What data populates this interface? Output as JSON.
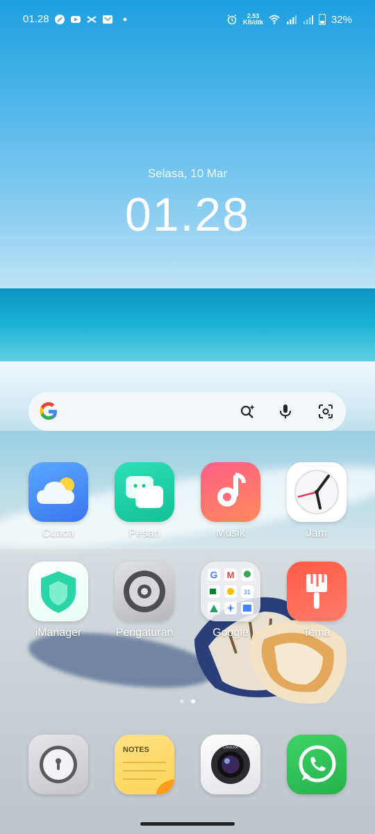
{
  "status_bar": {
    "time": "01.28",
    "net_speed_value": "2.53",
    "net_speed_unit": "KB/dtk",
    "battery": "32%",
    "left_icons": [
      "app-notification-icon",
      "youtube-icon",
      "capcut-icon",
      "mail-icon",
      "more-notifications-dot-icon"
    ],
    "right_icons": [
      "alarm-icon",
      "wifi-icon",
      "signal-icon",
      "signal-icon",
      "battery-icon"
    ]
  },
  "clock": {
    "date": "Selasa, 10 Mar",
    "time": "01.28"
  },
  "search_bar": {
    "icons": [
      "google-logo-icon",
      "ai-search-icon",
      "microphone-icon",
      "lens-icon"
    ]
  },
  "apps": [
    {
      "label": "Cuaca",
      "icon": "weather-icon",
      "color": "#4f8ff7"
    },
    {
      "label": "Pesan",
      "icon": "messages-icon",
      "color": "#1fd0a6"
    },
    {
      "label": "Musik",
      "icon": "music-icon",
      "color": "#ff4f7b"
    },
    {
      "label": "Jam",
      "icon": "clock-icon",
      "color": "#ffffff"
    },
    {
      "label": "iManager",
      "icon": "shield-icon",
      "color": "#27d7a5"
    },
    {
      "label": "Pengaturan",
      "icon": "gear-icon",
      "color": "#c8c8cc"
    },
    {
      "label": "Google",
      "icon": "google-folder-icon",
      "color": "#eef0f3"
    },
    {
      "label": "Tema",
      "icon": "paintbrush-icon",
      "color": "#ff5a4a"
    }
  ],
  "dock": [
    {
      "icon": "lock-icon",
      "color": "#d8d8dc"
    },
    {
      "icon": "notes-icon",
      "color": "#ffd968",
      "text": "NOTES"
    },
    {
      "icon": "camera-icon",
      "color": "#f2f2f4",
      "text": "CAMERA"
    },
    {
      "icon": "whatsapp-icon",
      "color": "#34c758"
    }
  ],
  "page_indicator": {
    "pages": 2,
    "current": 2
  }
}
